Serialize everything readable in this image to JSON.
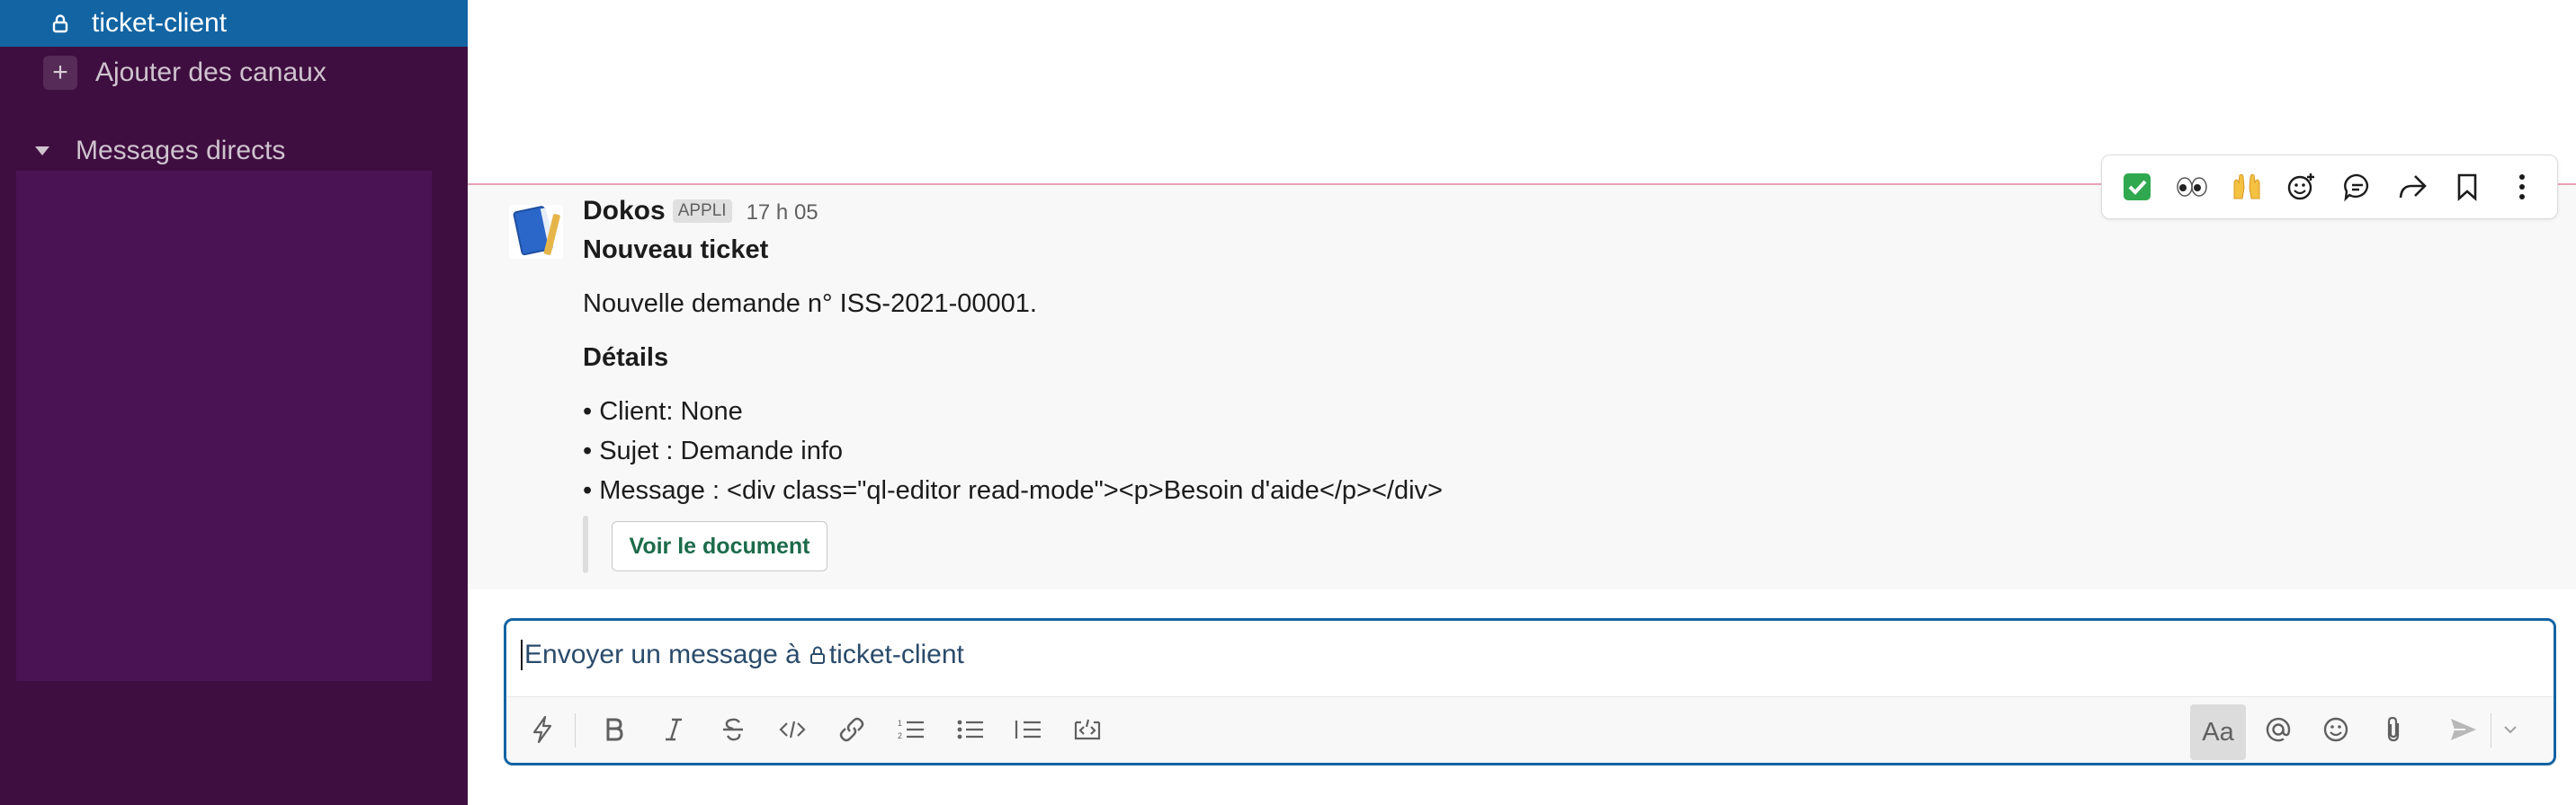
{
  "sidebar": {
    "active_channel": "ticket-client",
    "add_channels": "Ajouter des canaux",
    "direct_messages": "Messages directs"
  },
  "message": {
    "author": "Dokos",
    "badge": "APPLI",
    "time": "17 h 05",
    "title": "Nouveau ticket",
    "line1": "Nouvelle demande n° ISS-2021-00001.",
    "details_heading": "Détails",
    "bullets": [
      "• Client: None",
      "• Sujet : Demande info",
      "• Message : <div class=\"ql-editor read-mode\"><p>Besoin d'aide</p></div>"
    ],
    "button_label": "Voir le document"
  },
  "hover_actions": {
    "emoji_check": "✅",
    "emoji_eyes": "👀",
    "emoji_hands": "🙌"
  },
  "composer": {
    "placeholder_prefix": "Envoyer un message à ",
    "channel": "ticket-client",
    "format_label": "Aa"
  },
  "colors": {
    "sidebar_bg": "#3f0e40",
    "active_bg": "#1264a3",
    "button_text": "#1c6b4a"
  }
}
